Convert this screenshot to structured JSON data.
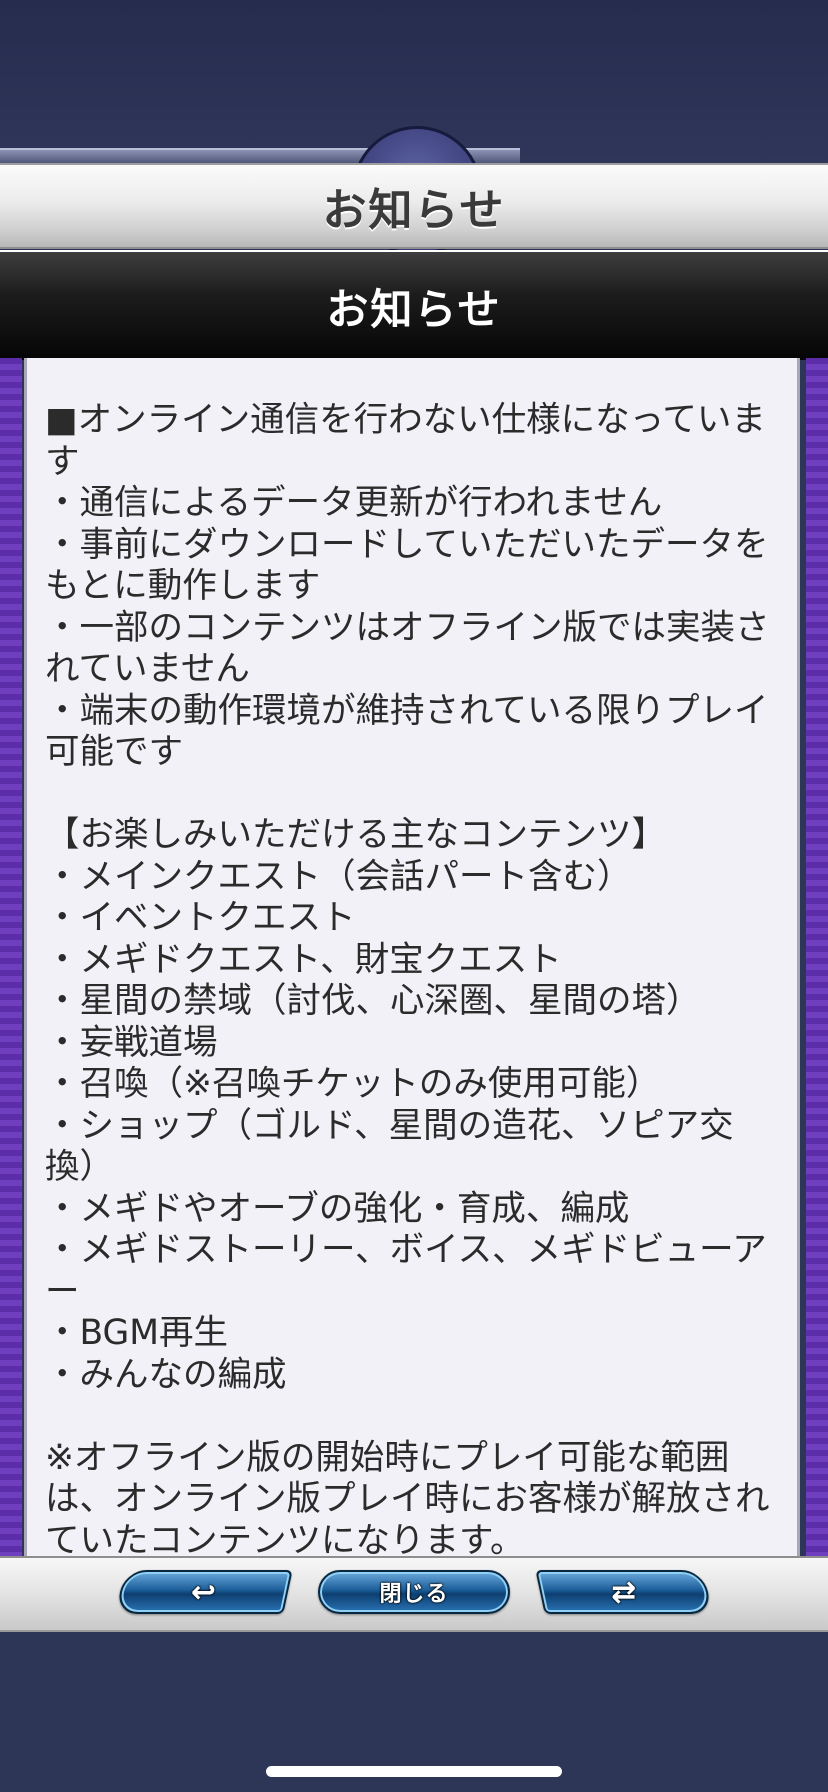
{
  "header": {
    "title": "お知らせ"
  },
  "subheader": {
    "title": "お知らせ"
  },
  "content": {
    "text": "■オンライン通信を行わない仕様になっています\n・通信によるデータ更新が行われません\n・事前にダウンロードしていただいたデータをもとに動作します\n・一部のコンテンツはオフライン版では実装されていません\n・端末の動作環境が維持されている限りプレイ可能です\n\n【お楽しみいただける主なコンテンツ】\n・メインクエスト（会話パート含む）\n・イベントクエスト\n・メギドクエスト、財宝クエスト\n・星間の禁域（討伐、心深圏、星間の塔）\n・妄戦道場\n・召喚（※召喚チケットのみ使用可能）\n・ショップ（ゴルド、星間の造花、ソピア交換）\n・メギドやオーブの強化・育成、編成\n・メギドストーリー、ボイス、メギドビューアー\n・BGM再生\n・みんなの編成\n\n※オフライン版の開始時にプレイ可能な範囲は、オンライン版プレイ時にお客様が解放されていたコンテンツになります。"
  },
  "footer": {
    "back_icon": "↩",
    "close_label": "閉じる",
    "switch_icon": "⇄"
  },
  "colors": {
    "background": "#2e3657",
    "frame_purple": "#5b2da8",
    "panel": "#f2f1f7",
    "button_blue": "#1c5e99"
  },
  "icons": {
    "back": "back-arrow-icon",
    "switch": "switch-arrows-icon"
  }
}
